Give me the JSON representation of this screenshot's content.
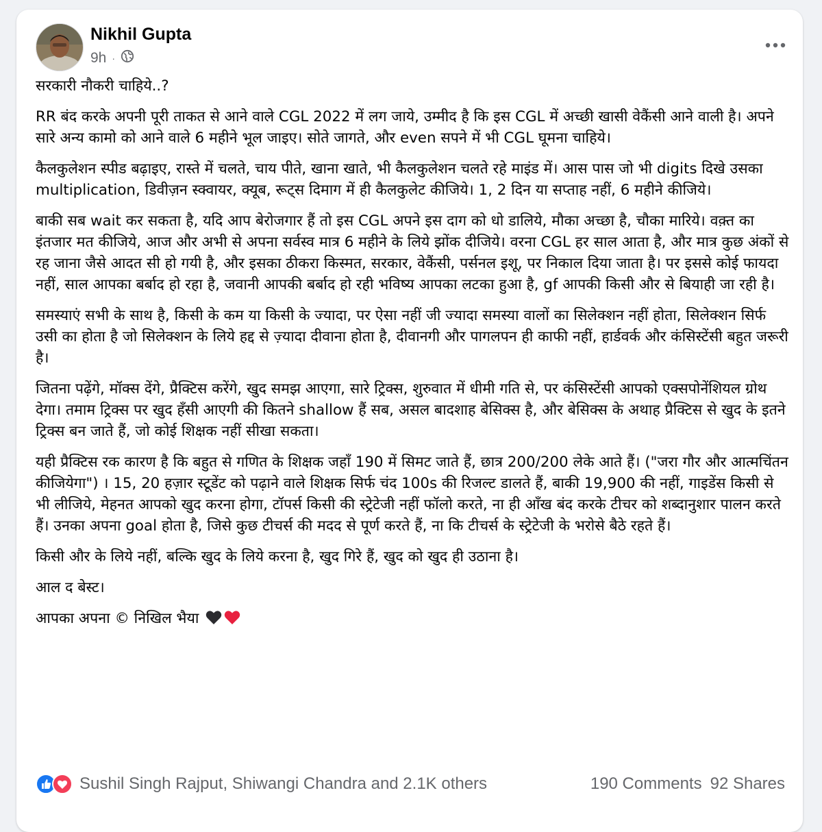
{
  "post": {
    "author": "Nikhil Gupta",
    "time": "9h",
    "visibility_icon": "globe-icon",
    "paragraphs": [
      "सरकारी नौकरी चाहिये..?",
      "RR बंद करके अपनी पूरी ताकत से आने वाले CGL 2022 में लग जाये, उम्मीद है कि इस CGL में अच्छी खासी वेकैंसी आने वाली है। अपने सारे अन्य कामो को आने वाले 6 महीने भूल जाइए। सोते जागते, और even सपने में भी CGL घूमना चाहिये।",
      "कैलकुलेशन स्पीड बढ़ाइए, रास्ते में चलते, चाय पीते, खाना खाते, भी कैलकुलेशन चलते रहे माइंड में। आस पास जो भी digits दिखे उसका multiplication, डिवीज़न स्क्वायर, क्यूब, रूट्स दिमाग में ही कैलकुलेट कीजिये। 1, 2 दिन या सप्ताह नहीं, 6 महीने कीजिये।",
      "बाकी सब wait कर सकता है, यदि आप बेरोजगार हैं तो इस CGL अपने इस दाग को धो डालिये, मौका अच्छा है, चौका मारिये। वक़्त का इंतजार मत कीजिये, आज और अभी से अपना सर्वस्व मात्र 6 महीने के लिये झोंक दीजिये। वरना CGL हर साल आता है, और मात्र कुछ अंकों से रह जाना जैसे आदत सी हो गयी है, और इसका ठीकरा किस्मत, सरकार, वेकैंसी, पर्सनल इशू, पर निकाल दिया जाता है। पर इससे कोई फायदा नहीं, साल आपका बर्बाद हो रहा है, जवानी आपकी बर्बाद हो रही भविष्य आपका लटका हुआ है, gf आपकी किसी और से बियाही जा रही है।",
      "समस्याएं सभी के साथ है, किसी के कम या किसी के ज्यादा, पर ऐसा नहीं जी ज्यादा समस्या वालों का सिलेक्शन नहीं होता, सिलेक्शन सिर्फ उसी का होता है जो सिलेक्शन के लिये हद्द से ज़्यादा दीवाना होता है, दीवानगी और पागलपन ही काफी नहीं, हार्डवर्क और कंसिस्टेंसी बहुत जरूरी है।",
      "जितना पढ़ेंगे, मॉक्स देंगे, प्रैक्टिस करेंगे, खुद समझ आएगा, सारे ट्रिक्स, शुरुवात में धीमी गति से, पर कंसिस्टेंसी आपको एक्सपोनेंशियल ग्रोथ देगा। तमाम ट्रिक्स पर खुद हँसी आएगी की कितने shallow हैं सब, असल बादशाह बेसिक्स है, और बेसिक्स के अथाह प्रैक्टिस से खुद के इतने ट्रिक्स बन जाते हैं, जो कोई शिक्षक नहीं सीखा सकता।",
      "यही प्रैक्टिस रक कारण है कि बहुत से गणित के शिक्षक जहाँ 190 में सिमट जाते हैं, छात्र 200/200 लेके आते हैं। (\"जरा गौर और आत्मचिंतन कीजियेगा\") । 15, 20 हज़ार स्टूडेंट को पढ़ाने वाले शिक्षक सिर्फ चंद 100s की रिजल्ट डालते हैं, बाकी 19,900 की नहीं, गाइडेंस किसी से भी लीजिये, मेहनत आपको खुद करना होगा, टॉपर्स किसी की स्ट्रेटेजी नहीं फॉलो करते, ना ही आँख बंद करके टीचर को शब्दानुशार पालन करते हैं। उनका अपना goal होता है, जिसे कुछ टीचर्स की मदद से पूर्ण करते हैं, ना कि टीचर्स के स्ट्रेटेजी के भरोसे बैठे रहते हैं।",
      "किसी और के लिये नहीं, बल्कि खुद के लिये करना है, खुद गिरे हैं, खुद को खुद ही उठाना है।",
      "आल द बेस्ट।",
      "आपका अपना © निखिल भैया"
    ],
    "signature_emojis": [
      "black-heart-icon",
      "red-heart-icon"
    ],
    "reactions_text": "Sushil Singh Rajput, Shiwangi Chandra and 2.1K others",
    "reaction_icons": [
      "like-icon",
      "love-icon"
    ],
    "comments_text": "190 Comments",
    "shares_text": "92 Shares"
  },
  "colors": {
    "like_blue": "#1877f2",
    "love_red": "#f33e58",
    "meta_gray": "#65676b"
  }
}
